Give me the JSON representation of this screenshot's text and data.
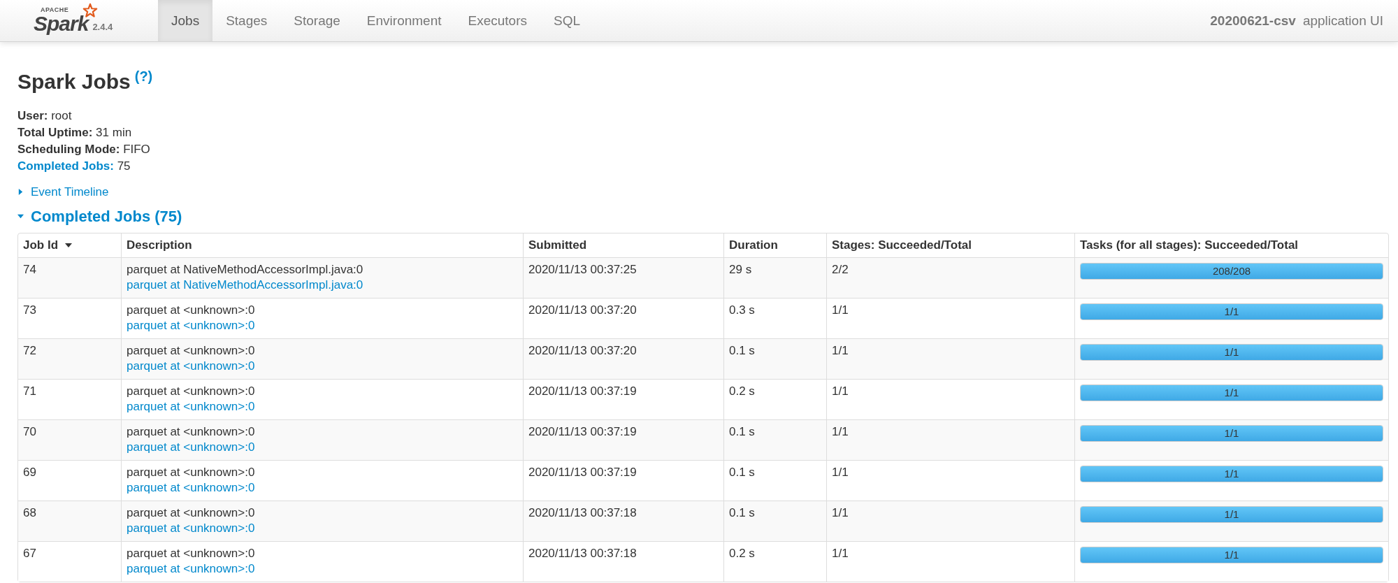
{
  "navbar": {
    "logo": {
      "tag": "APACHE",
      "name": "Spark",
      "version": "2.4.4"
    },
    "tabs": [
      {
        "label": "Jobs",
        "selected": true
      },
      {
        "label": "Stages",
        "selected": false
      },
      {
        "label": "Storage",
        "selected": false
      },
      {
        "label": "Environment",
        "selected": false
      },
      {
        "label": "Executors",
        "selected": false
      },
      {
        "label": "SQL",
        "selected": false
      }
    ],
    "app_name": "20200621-csv",
    "app_suffix": "application UI"
  },
  "title": "Spark Jobs",
  "help": "(?)",
  "summary": [
    {
      "label": "User:",
      "value": "root",
      "link": false
    },
    {
      "label": "Total Uptime:",
      "value": "31 min",
      "link": false
    },
    {
      "label": "Scheduling Mode:",
      "value": "FIFO",
      "link": false
    },
    {
      "label": "Completed Jobs:",
      "value": "75",
      "link": true
    }
  ],
  "event_timeline": {
    "label": "Event Timeline",
    "expanded": false
  },
  "completed_jobs": {
    "label": "Completed Jobs (75)",
    "expanded": true
  },
  "table": {
    "columns": [
      {
        "label": "Job Id",
        "sorted": true
      },
      {
        "label": "Description",
        "sorted": false
      },
      {
        "label": "Submitted",
        "sorted": false
      },
      {
        "label": "Duration",
        "sorted": false
      },
      {
        "label": "Stages: Succeeded/Total",
        "sorted": false
      },
      {
        "label": "Tasks (for all stages): Succeeded/Total",
        "sorted": false
      }
    ],
    "rows": [
      {
        "job_id": "74",
        "description": "parquet at NativeMethodAccessorImpl.java:0",
        "description_link": "parquet at NativeMethodAccessorImpl.java:0",
        "submitted": "2020/11/13 00:37:25",
        "duration": "29 s",
        "stages": "2/2",
        "tasks": "208/208",
        "level": 1
      },
      {
        "job_id": "73",
        "description": "parquet at <unknown>:0",
        "description_link": "parquet at <unknown>:0",
        "submitted": "2020/11/13 00:37:20",
        "duration": "0.3 s",
        "stages": "1/1",
        "tasks": "1/1",
        "level": 1
      },
      {
        "job_id": "72",
        "description": "parquet at <unknown>:0",
        "description_link": "parquet at <unknown>:0",
        "submitted": "2020/11/13 00:37:20",
        "duration": "0.1 s",
        "stages": "1/1",
        "tasks": "1/1",
        "level": 1
      },
      {
        "job_id": "71",
        "description": "parquet at <unknown>:0",
        "description_link": "parquet at <unknown>:0",
        "submitted": "2020/11/13 00:37:19",
        "duration": "0.2 s",
        "stages": "1/1",
        "tasks": "1/1",
        "level": 1
      },
      {
        "job_id": "70",
        "description": "parquet at <unknown>:0",
        "description_link": "parquet at <unknown>:0",
        "submitted": "2020/11/13 00:37:19",
        "duration": "0.1 s",
        "stages": "1/1",
        "tasks": "1/1",
        "level": 1
      },
      {
        "job_id": "69",
        "description": "parquet at <unknown>:0",
        "description_link": "parquet at <unknown>:0",
        "submitted": "2020/11/13 00:37:19",
        "duration": "0.1 s",
        "stages": "1/1",
        "tasks": "1/1",
        "level": 1
      },
      {
        "job_id": "68",
        "description": "parquet at <unknown>:0",
        "description_link": "parquet at <unknown>:0",
        "submitted": "2020/11/13 00:37:18",
        "duration": "0.1 s",
        "stages": "1/1",
        "tasks": "1/1",
        "level": 1
      },
      {
        "job_id": "67",
        "description": "parquet at <unknown>:0",
        "description_link": "parquet at <unknown>:0",
        "submitted": "2020/11/13 00:37:18",
        "duration": "0.2 s",
        "stages": "1/1",
        "tasks": "1/1",
        "level": 1
      }
    ]
  }
}
